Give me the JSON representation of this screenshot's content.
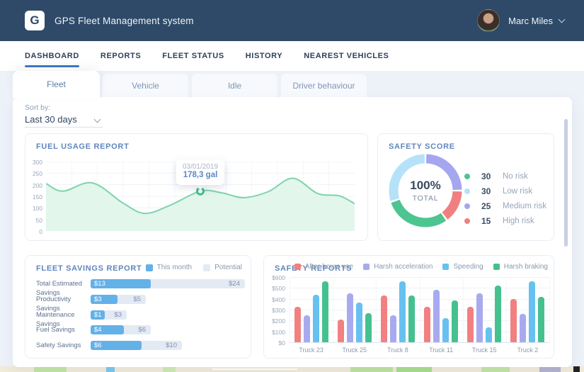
{
  "header": {
    "logo_letter": "G",
    "app_title": "GPS Fleet Management system",
    "user_name": "Marc Miles"
  },
  "nav": {
    "items": [
      {
        "label": "DASHBOARD",
        "active": true
      },
      {
        "label": "REPORTS",
        "active": false
      },
      {
        "label": "FLEET STATUS",
        "active": false
      },
      {
        "label": "HISTORY",
        "active": false
      },
      {
        "label": "NEAREST VEHICLES",
        "active": false
      }
    ]
  },
  "tabs": {
    "items": [
      {
        "label": "Fleet",
        "active": true
      },
      {
        "label": "Vehicle",
        "active": false
      },
      {
        "label": "Idle",
        "active": false
      },
      {
        "label": "Driver behaviour",
        "active": false
      }
    ]
  },
  "sort": {
    "label": "Sort by:",
    "value": "Last 30 days"
  },
  "colors": {
    "header_bg": "#2e4a68",
    "page_bg": "#edf1f8",
    "accent_blue": "#3c79c7",
    "title_blue": "#6086bd"
  },
  "chart_data": [
    {
      "id": "fuel_usage",
      "type": "area",
      "title": "FUEL USAGE REPORT",
      "ylim": [
        0,
        300
      ],
      "yticks": [
        0,
        50,
        100,
        150,
        200,
        250,
        300
      ],
      "grid": true,
      "line_color": "#7ed3ab",
      "fill_color": "#e2f6ec",
      "points": [
        [
          0,
          205
        ],
        [
          0.055,
          172
        ],
        [
          0.15,
          208
        ],
        [
          0.25,
          120
        ],
        [
          0.32,
          76
        ],
        [
          0.4,
          110
        ],
        [
          0.5,
          172
        ],
        [
          0.57,
          165
        ],
        [
          0.64,
          144
        ],
        [
          0.72,
          170
        ],
        [
          0.8,
          228
        ],
        [
          0.88,
          162
        ],
        [
          0.95,
          152
        ],
        [
          1,
          118
        ]
      ],
      "marker": {
        "x": 0.5,
        "value": 172,
        "color": "#45c18f",
        "tooltip_date": "03/01/2019",
        "tooltip_value": "178,3 gal"
      }
    },
    {
      "id": "safety_score",
      "type": "donut",
      "title": "SAFETY SCORE",
      "center": {
        "value": "100%",
        "label": "TOTAL"
      },
      "segments": [
        {
          "label": "No risk",
          "value": 30,
          "color": "#4dc591"
        },
        {
          "label": "Low risk",
          "value": 30,
          "color": "#b5e2f8"
        },
        {
          "label": "Medium risk",
          "value": 25,
          "color": "#a4a6f0"
        },
        {
          "label": "High risk",
          "value": 15,
          "color": "#f0807f"
        }
      ],
      "ring_order": [
        2,
        3,
        0,
        1
      ],
      "legend_position": "right"
    },
    {
      "id": "fleet_savings",
      "type": "bar",
      "orientation": "horizontal",
      "title": "FLEET SAVINGS REPORT",
      "series_names": [
        "This month",
        "Potential"
      ],
      "series_colors": [
        "#64b1e8",
        "#e4eaf3"
      ],
      "rows": [
        {
          "label": "Total Estimated Savings",
          "this_month": "$13",
          "potential": "$24",
          "this_pct": 39,
          "potential_pct": 100
        },
        {
          "label": "Productivity Savings",
          "this_month": "$3",
          "potential": "$5",
          "this_pct": 17.5,
          "potential_pct": 36
        },
        {
          "label": "Maintenance Savings",
          "this_month": "$1",
          "potential": "$3",
          "this_pct": 9,
          "potential_pct": 23.5
        },
        {
          "label": "Fuel Savings",
          "this_month": "$4",
          "potential": "$6",
          "this_pct": 21.5,
          "potential_pct": 39
        },
        {
          "label": "Safety Savings",
          "this_month": "$6",
          "potential": "$10",
          "this_pct": 33,
          "potential_pct": 59
        }
      ]
    },
    {
      "id": "safety_reports",
      "type": "bar",
      "orientation": "vertical",
      "title": "SAFETY REPORTS",
      "categories": [
        "Truck 23",
        "Truck 25",
        "Truck 8",
        "Truck 11",
        "Truck 15",
        "Truck 2"
      ],
      "series": [
        {
          "name": "After-hours use",
          "color": "#f28080",
          "values": [
            325,
            210,
            430,
            325,
            325,
            395
          ]
        },
        {
          "name": "Harsh acceleration",
          "color": "#a8aaf0",
          "values": [
            250,
            450,
            250,
            480,
            450,
            260
          ]
        },
        {
          "name": "Speeding",
          "color": "#67c1f0",
          "values": [
            440,
            365,
            560,
            225,
            135,
            560
          ]
        },
        {
          "name": "Harsh braking",
          "color": "#45c18f",
          "values": [
            560,
            270,
            430,
            385,
            525,
            420
          ]
        }
      ],
      "ylim": [
        0,
        600
      ],
      "yticks": [
        "$0",
        "$100",
        "$200",
        "$300",
        "$400",
        "$500",
        "$600"
      ]
    }
  ]
}
